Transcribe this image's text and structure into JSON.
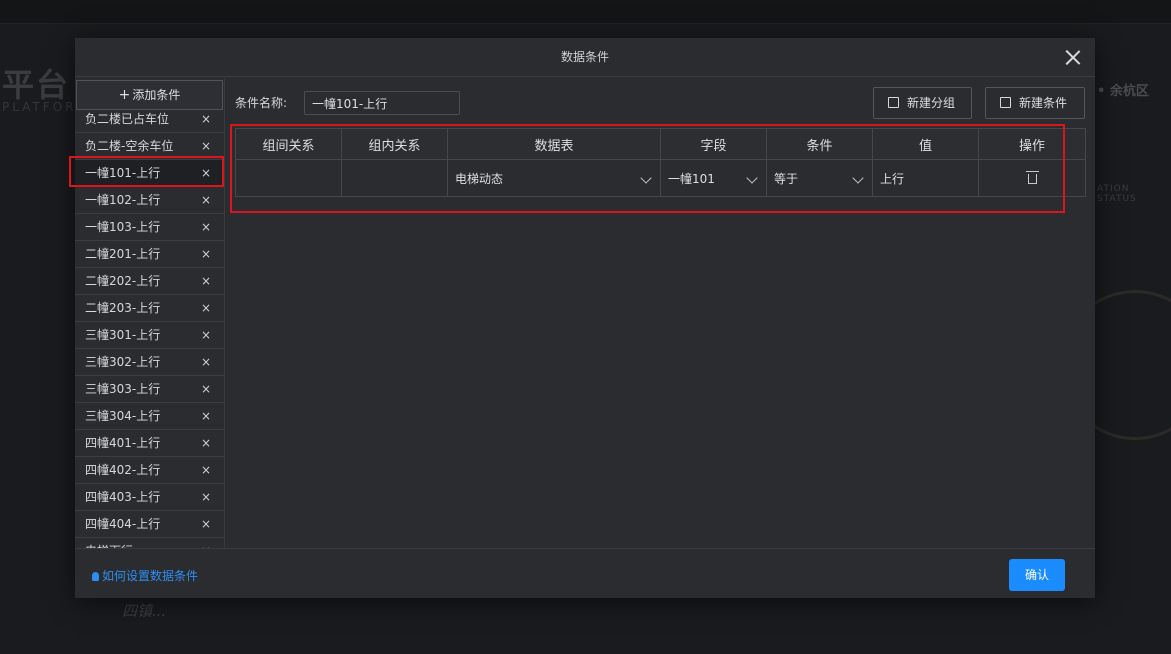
{
  "background": {
    "title": "平台",
    "subtitle": "PLATFORM",
    "region": "• 余杭区",
    "status_label": "ATION STATUS",
    "handwriting": "四镇..."
  },
  "modal": {
    "title": "数据条件",
    "add_button_label": "添加条件",
    "condition_items": [
      {
        "label": "负二楼已占车位",
        "remove": "×"
      },
      {
        "label": "负二楼-空余车位",
        "remove": "×"
      },
      {
        "label": "一幢101-上行",
        "remove": "×"
      },
      {
        "label": "一幢102-上行",
        "remove": "×"
      },
      {
        "label": "一幢103-上行",
        "remove": "×"
      },
      {
        "label": "二幢201-上行",
        "remove": "×"
      },
      {
        "label": "二幢202-上行",
        "remove": "×"
      },
      {
        "label": "二幢203-上行",
        "remove": "×"
      },
      {
        "label": "三幢301-上行",
        "remove": "×"
      },
      {
        "label": "三幢302-上行",
        "remove": "×"
      },
      {
        "label": "三幢303-上行",
        "remove": "×"
      },
      {
        "label": "三幢304-上行",
        "remove": "×"
      },
      {
        "label": "四幢401-上行",
        "remove": "×"
      },
      {
        "label": "四幢402-上行",
        "remove": "×"
      },
      {
        "label": "四幢403-上行",
        "remove": "×"
      },
      {
        "label": "四幢404-上行",
        "remove": "×"
      },
      {
        "label": "电梯下行",
        "remove": "×"
      }
    ],
    "active_index": 2,
    "name_label": "条件名称:",
    "name_value": "一幢101-上行",
    "new_group_label": "新建分组",
    "new_condition_label": "新建条件",
    "table": {
      "headers": [
        "组间关系",
        "组内关系",
        "数据表",
        "字段",
        "条件",
        "值",
        "操作"
      ],
      "row": {
        "group_relation": "",
        "inner_relation": "",
        "data_table": "电梯动态",
        "field": "一幢101",
        "condition": "等于",
        "value": "上行",
        "action_icon": "trash-icon"
      }
    },
    "help_link": "如何设置数据条件",
    "confirm_label": "确认"
  }
}
